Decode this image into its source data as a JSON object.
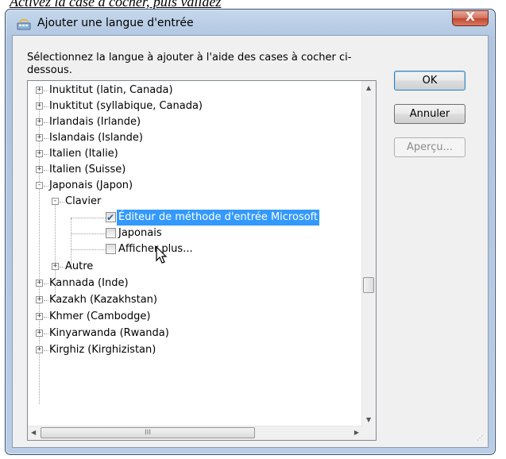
{
  "top_caption": "Activez la case à cocher, puis validez",
  "window": {
    "title": "Ajouter une langue d'entrée",
    "instructions": "Sélectionnez la langue à ajouter à l'aide des cases à cocher ci-dessous.",
    "close_label": "X",
    "icon": "keyboard-icon"
  },
  "buttons": {
    "ok": "OK",
    "cancel": "Annuler",
    "preview": "Aperçu..."
  },
  "tree": {
    "items": [
      {
        "label": "Inuktitut (latin, Canada)",
        "expander": "+"
      },
      {
        "label": "Inuktitut (syllabique, Canada)",
        "expander": "+"
      },
      {
        "label": "Irlandais (Irlande)",
        "expander": "+"
      },
      {
        "label": "Islandais (Islande)",
        "expander": "+"
      },
      {
        "label": "Italien (Italie)",
        "expander": "+"
      },
      {
        "label": "Italien (Suisse)",
        "expander": "+"
      },
      {
        "label": "Japonais (Japon)",
        "expander": "-"
      },
      {
        "label": "Clavier",
        "expander": "-"
      },
      {
        "label": "Éditeur de méthode d'entrée Microsoft",
        "checked": true,
        "selected": true
      },
      {
        "label": "Japonais",
        "checked": false
      },
      {
        "label": "Afficher plus...",
        "checked": false
      },
      {
        "label": "Autre",
        "expander": "+"
      },
      {
        "label": "Kannada (Inde)",
        "expander": "+"
      },
      {
        "label": "Kazakh (Kazakhstan)",
        "expander": "+"
      },
      {
        "label": "Khmer (Cambodge)",
        "expander": "+"
      },
      {
        "label": "Kinyarwanda (Rwanda)",
        "expander": "+"
      },
      {
        "label": "Kirghiz (Kirghizistan)",
        "expander": "+"
      }
    ]
  },
  "scrollbars": {
    "h_thumb_grip": "III"
  }
}
